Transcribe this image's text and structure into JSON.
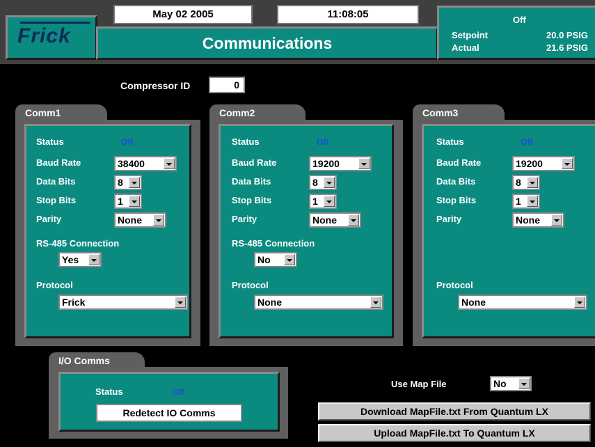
{
  "header": {
    "logo": "Frick",
    "date": "May 02 2005",
    "time": "11:08:05",
    "title": "Communications",
    "state": "Off",
    "setpoint_label": "Setpoint",
    "setpoint_value": "20.0 PSIG",
    "actual_label": "Actual",
    "actual_value": "21.6 PSIG"
  },
  "compressor_id": {
    "label": "Compressor ID",
    "value": "0"
  },
  "labels": {
    "status": "Status",
    "baud_rate": "Baud Rate",
    "data_bits": "Data Bits",
    "stop_bits": "Stop Bits",
    "parity": "Parity",
    "rs485": "RS-485 Connection",
    "protocol": "Protocol"
  },
  "comm1": {
    "tab": "Comm1",
    "status": "Off",
    "baud_rate": "38400",
    "data_bits": "8",
    "stop_bits": "1",
    "parity": "None",
    "rs485": "Yes",
    "protocol": "Frick"
  },
  "comm2": {
    "tab": "Comm2",
    "status": "Off",
    "baud_rate": "19200",
    "data_bits": "8",
    "stop_bits": "1",
    "parity": "None",
    "rs485": "No",
    "protocol": "None"
  },
  "comm3": {
    "tab": "Comm3",
    "status": "Off",
    "baud_rate": "19200",
    "data_bits": "8",
    "stop_bits": "1",
    "parity": "None",
    "protocol": "None"
  },
  "io_comms": {
    "tab": "I/O Comms",
    "status_label": "Status",
    "status": "Off",
    "redetect_button": "Redetect IO Comms"
  },
  "map_file": {
    "label": "Use Map File",
    "value": "No",
    "download_button": "Download MapFile.txt From Quantum LX",
    "upload_button": "Upload MapFile.txt To Quantum LX"
  },
  "colors": {
    "panel_teal": "#0b8a80",
    "frame_grey": "#5f5f5f",
    "status_blue": "#1a4fd0"
  }
}
